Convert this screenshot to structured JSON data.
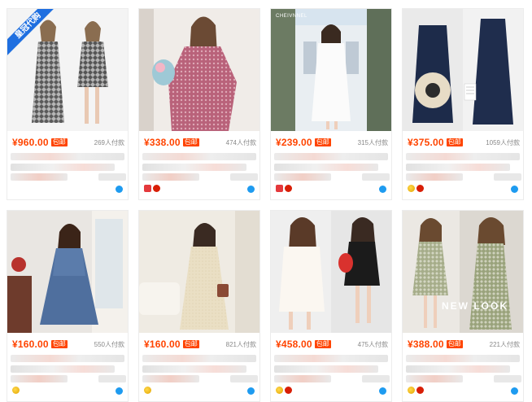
{
  "colors": {
    "price": "#ff4400",
    "baoyou_badge": "#ff4400",
    "chat_icon": "#1e9bf0",
    "ribbon": "#1f6fe0"
  },
  "products": [
    {
      "price": "¥960.00",
      "badge": "包邮",
      "sold": "269人付款",
      "ribbon": "皇冠代购",
      "badges": [],
      "icon": "chat-icon"
    },
    {
      "price": "¥338.00",
      "badge": "包邮",
      "sold": "474人付款",
      "badges": [
        "red",
        "red2"
      ],
      "icon": "chat-icon"
    },
    {
      "price": "¥239.00",
      "badge": "包邮",
      "sold": "315人付款",
      "photo_text": "CHEIVNNEL",
      "badges": [
        "red",
        "red2"
      ],
      "icon": "chat-icon"
    },
    {
      "price": "¥375.00",
      "badge": "包邮",
      "sold": "1059人付款",
      "badges": [
        "gold",
        "red2"
      ],
      "icon": "chat-icon"
    },
    {
      "price": "¥160.00",
      "badge": "包邮",
      "sold": "550人付款",
      "badges": [
        "gold"
      ],
      "icon": "chat-icon"
    },
    {
      "price": "¥160.00",
      "badge": "包邮",
      "sold": "821人付款",
      "badges": [
        "gold"
      ],
      "icon": "chat-icon"
    },
    {
      "price": "¥458.00",
      "badge": "包邮",
      "sold": "475人付款",
      "badges": [
        "gold",
        "red2"
      ],
      "icon": "chat-icon"
    },
    {
      "price": "¥388.00",
      "badge": "包邮",
      "sold": "221人付款",
      "photo_text": "NEW LOOK",
      "badges": [
        "gold",
        "red2"
      ],
      "icon": "chat-icon"
    }
  ]
}
